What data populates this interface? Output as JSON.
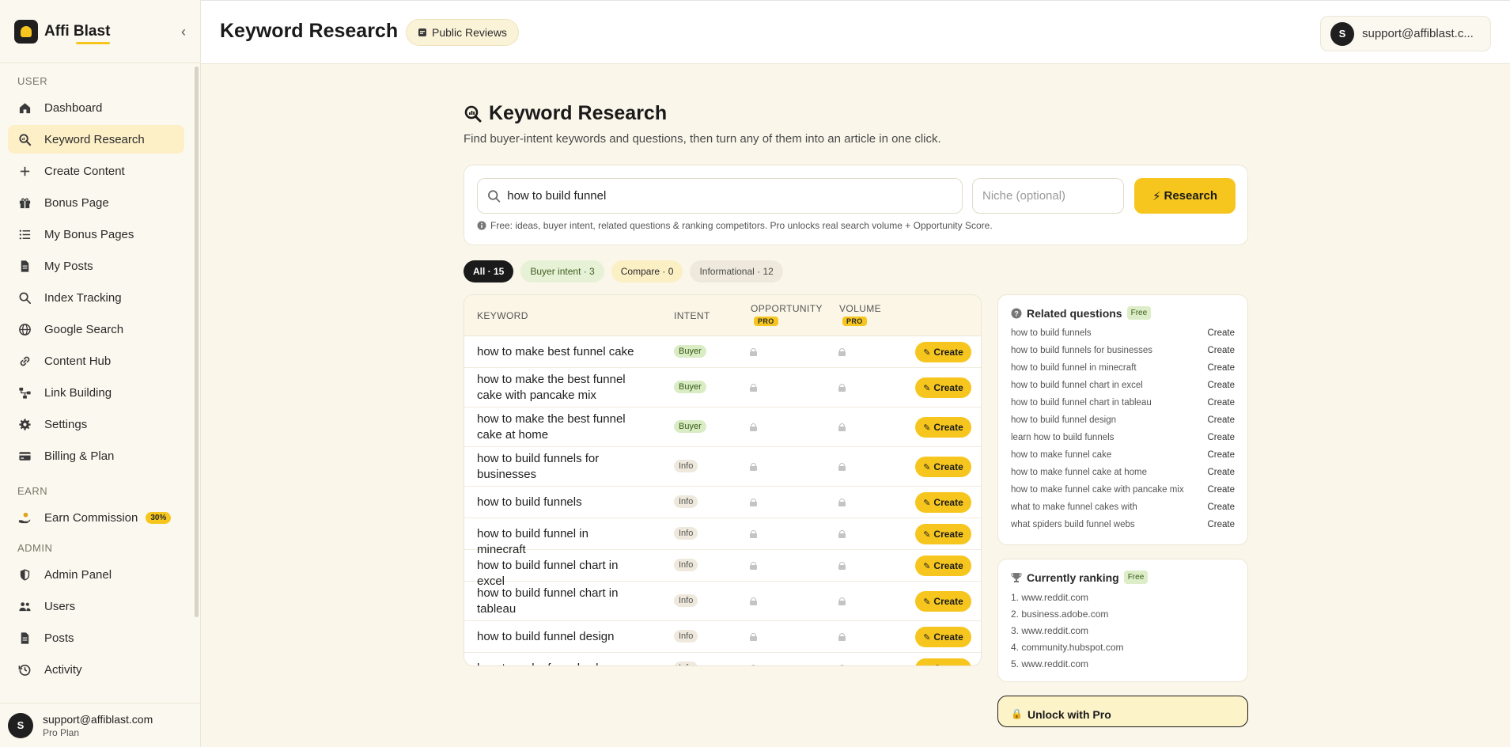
{
  "brand": {
    "name": "Affi Blast"
  },
  "sidebar": {
    "sections": {
      "user": "USER",
      "earn": "EARN",
      "admin": "ADMIN"
    },
    "user_items": [
      {
        "label": "Dashboard",
        "icon": "home-icon"
      },
      {
        "label": "Keyword Research",
        "icon": "keyword-search-icon",
        "active": true
      },
      {
        "label": "Create Content",
        "icon": "plus-icon"
      },
      {
        "label": "Bonus Page",
        "icon": "gift-icon"
      },
      {
        "label": "My Bonus Pages",
        "icon": "list-icon"
      },
      {
        "label": "My Posts",
        "icon": "document-icon"
      },
      {
        "label": "Index Tracking",
        "icon": "search-icon"
      },
      {
        "label": "Google Search",
        "icon": "globe-icon"
      },
      {
        "label": "Content Hub",
        "icon": "link-icon"
      },
      {
        "label": "Link Building",
        "icon": "network-icon"
      },
      {
        "label": "Settings",
        "icon": "gear-icon"
      },
      {
        "label": "Billing & Plan",
        "icon": "credit-card-icon"
      }
    ],
    "earn_items": [
      {
        "label": "Earn Commission",
        "icon": "hand-coin-icon",
        "badge": "30%"
      }
    ],
    "admin_items": [
      {
        "label": "Admin Panel",
        "icon": "shield-icon"
      },
      {
        "label": "Users",
        "icon": "users-icon"
      },
      {
        "label": "Posts",
        "icon": "document-icon"
      },
      {
        "label": "Activity",
        "icon": "history-icon"
      }
    ],
    "footer": {
      "avatar": "S",
      "email": "support@affiblast.com",
      "plan": "Pro Plan"
    }
  },
  "header": {
    "title": "Keyword Research",
    "public_reviews": "Public Reviews",
    "account_avatar": "S",
    "account_email": "support@affiblast.c..."
  },
  "main": {
    "title": "Keyword Research",
    "subtitle": "Find buyer-intent keywords and questions, then turn any of them into an article in one click.",
    "search": {
      "value": "how to build funnel",
      "niche_placeholder": "Niche (optional)",
      "button": "Research"
    },
    "note": "Free: ideas, buyer intent, related questions & ranking competitors. Pro unlocks real search volume + Opportunity Score.",
    "filters": {
      "all": "All · 15",
      "buyer": "Buyer intent · 3",
      "compare": "Compare · 0",
      "info": "Informational · 12"
    },
    "table": {
      "headers": {
        "keyword": "KEYWORD",
        "intent": "INTENT",
        "opportunity": "OPPORTUNITY",
        "volume": "VOLUME",
        "pro": "PRO"
      },
      "create_label": "Create",
      "rows": [
        {
          "keyword": "how to make best funnel cake",
          "intent": "Buyer",
          "type": "buyer"
        },
        {
          "keyword": "how to make the best funnel cake with pancake mix",
          "intent": "Buyer",
          "type": "buyer"
        },
        {
          "keyword": "how to make the best funnel cake at home",
          "intent": "Buyer",
          "type": "buyer"
        },
        {
          "keyword": "how to build funnels for businesses",
          "intent": "Info",
          "type": "info"
        },
        {
          "keyword": "how to build funnels",
          "intent": "Info",
          "type": "info"
        },
        {
          "keyword": "how to build funnel in minecraft",
          "intent": "Info",
          "type": "info"
        },
        {
          "keyword": "how to build funnel chart in excel",
          "intent": "Info",
          "type": "info"
        },
        {
          "keyword": "how to build funnel chart in tableau",
          "intent": "Info",
          "type": "info"
        },
        {
          "keyword": "how to build funnel design",
          "intent": "Info",
          "type": "info"
        },
        {
          "keyword": "how to make funnel cake",
          "intent": "Info",
          "type": "info"
        }
      ]
    },
    "related": {
      "title": "Related questions",
      "free": "Free",
      "create_label": "Create",
      "questions": [
        "how to build funnels",
        "how to build funnels for businesses",
        "how to build funnel in minecraft",
        "how to build funnel chart in excel",
        "how to build funnel chart in tableau",
        "how to build funnel design",
        "learn how to build funnels",
        "how to make funnel cake",
        "how to make funnel cake at home",
        "how to make funnel cake with pancake mix",
        "what to make funnel cakes with",
        "what spiders build funnel webs"
      ]
    },
    "ranking": {
      "title": "Currently ranking",
      "free": "Free",
      "sites": [
        "1. www.reddit.com",
        "2. business.adobe.com",
        "3. www.reddit.com",
        "4. community.hubspot.com",
        "5. www.reddit.com"
      ]
    },
    "unlock": "Unlock with Pro"
  }
}
